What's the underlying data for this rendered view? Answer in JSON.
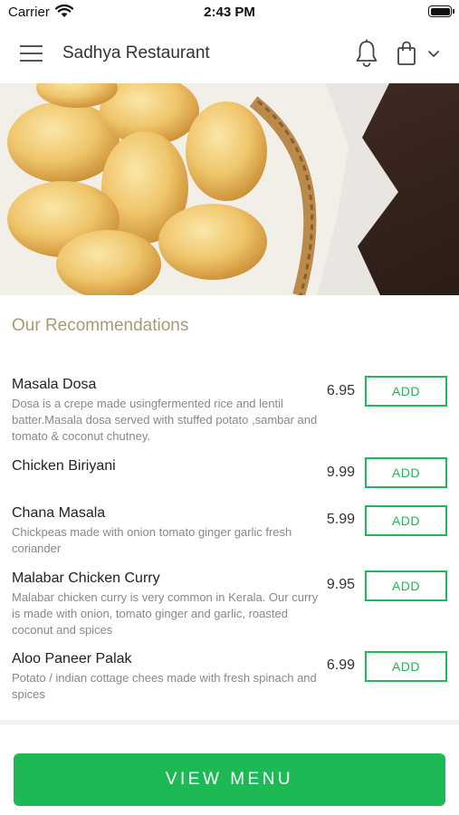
{
  "status_bar": {
    "carrier": "Carrier",
    "time": "2:43 PM"
  },
  "header": {
    "title": "Sadhya Restaurant"
  },
  "section": {
    "title": "Our Recommendations"
  },
  "add_label": "ADD",
  "items": [
    {
      "name": "Masala Dosa",
      "desc": "Dosa is a crepe made usingfermented rice and lentil batter.Masala dosa served with stuffed potato ,sambar and tomato & coconut chutney.",
      "price": "6.95"
    },
    {
      "name": "Chicken Biriyani",
      "desc": "",
      "price": "9.99"
    },
    {
      "name": "Chana Masala",
      "desc": "Chickpeas made with onion tomato ginger garlic fresh coriander",
      "price": "5.99"
    },
    {
      "name": "Malabar Chicken Curry",
      "desc": "Malabar chicken curry is very common in Kerala. Our curry is made with onion, tomato ginger and garlic, roasted coconut and spices",
      "price": "9.95"
    },
    {
      "name": "Aloo Paneer Palak",
      "desc": "Potato / indian cottage chees made with fresh spinach and spices",
      "price": "6.99"
    }
  ],
  "footer": {
    "view_menu_label": "VIEW MENU"
  },
  "colors": {
    "accent": "#1db954",
    "section_title": "#a89a72"
  }
}
